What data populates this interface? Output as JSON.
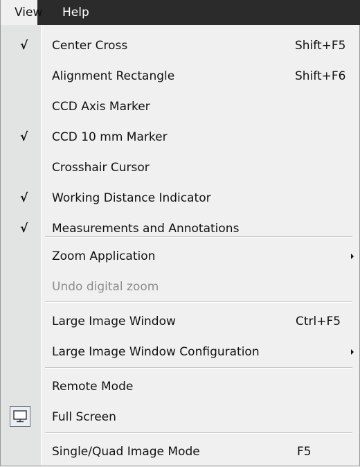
{
  "menubar": {
    "view_label": "View",
    "help_label": "Help"
  },
  "menu": {
    "items": [
      {
        "label": "Center Cross",
        "shortcut": "Shift+F5",
        "checked": "√"
      },
      {
        "label": "Alignment Rectangle",
        "shortcut": "Shift+F6"
      },
      {
        "label": "CCD Axis Marker"
      },
      {
        "label": "CCD 10 mm Marker",
        "checked": "√"
      },
      {
        "label": "Crosshair Cursor"
      },
      {
        "label": "Working Distance Indicator",
        "checked": "√"
      },
      {
        "label": "Measurements and Annotations",
        "checked": "√"
      },
      {
        "label": "Zoom Application",
        "submenu": true
      },
      {
        "label": "Undo digital zoom",
        "disabled": true
      },
      {
        "label": "Large Image Window",
        "shortcut": "Ctrl+F5"
      },
      {
        "label": "Large Image Window Configuration",
        "submenu": true
      },
      {
        "label": "Remote Mode"
      },
      {
        "label": "Full Screen",
        "icon": "monitor-icon"
      },
      {
        "label": "Single/Quad Image Mode",
        "shortcut": "F5"
      }
    ]
  }
}
